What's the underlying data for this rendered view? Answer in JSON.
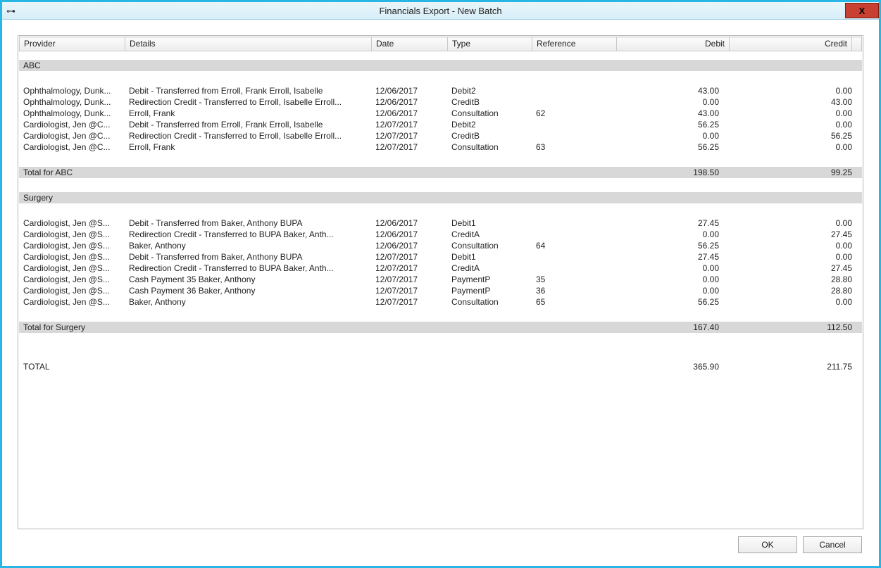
{
  "window": {
    "title": "Financials Export - New Batch",
    "close_label": "X"
  },
  "columns": {
    "provider": "Provider",
    "details": "Details",
    "date": "Date",
    "type": "Type",
    "reference": "Reference",
    "debit": "Debit",
    "credit": "Credit"
  },
  "groups": [
    {
      "name": "ABC",
      "total_label": "Total for ABC",
      "total_debit": "198.50",
      "total_credit": "99.25",
      "rows": [
        {
          "provider": "Ophthalmology, Dunk...",
          "details": "Debit - Transferred from Erroll, Frank   Erroll, Isabelle",
          "date": "12/06/2017",
          "type": "Debit2",
          "reference": "",
          "debit": "43.00",
          "credit": "0.00"
        },
        {
          "provider": "Ophthalmology, Dunk...",
          "details": "Redirection Credit - Transferred to Erroll, Isabelle   Erroll...",
          "date": "12/06/2017",
          "type": "CreditB",
          "reference": "",
          "debit": "0.00",
          "credit": "43.00"
        },
        {
          "provider": "Ophthalmology, Dunk...",
          "details": "   Erroll, Frank",
          "date": "12/06/2017",
          "type": "Consultation",
          "reference": "62",
          "debit": "43.00",
          "credit": "0.00"
        },
        {
          "provider": "Cardiologist, Jen @C...",
          "details": "Debit - Transferred from Erroll, Frank   Erroll, Isabelle",
          "date": "12/07/2017",
          "type": "Debit2",
          "reference": "",
          "debit": "56.25",
          "credit": "0.00"
        },
        {
          "provider": "Cardiologist, Jen @C...",
          "details": "Redirection Credit - Transferred to Erroll, Isabelle   Erroll...",
          "date": "12/07/2017",
          "type": "CreditB",
          "reference": "",
          "debit": "0.00",
          "credit": "56.25"
        },
        {
          "provider": "Cardiologist, Jen @C...",
          "details": "   Erroll, Frank",
          "date": "12/07/2017",
          "type": "Consultation",
          "reference": "63",
          "debit": "56.25",
          "credit": "0.00"
        }
      ]
    },
    {
      "name": "Surgery",
      "total_label": "Total for Surgery",
      "total_debit": "167.40",
      "total_credit": "112.50",
      "rows": [
        {
          "provider": "Cardiologist, Jen @S...",
          "details": "Debit - Transferred from Baker, Anthony   BUPA",
          "date": "12/06/2017",
          "type": "Debit1",
          "reference": "",
          "debit": "27.45",
          "credit": "0.00"
        },
        {
          "provider": "Cardiologist, Jen @S...",
          "details": "Redirection Credit - Transferred to BUPA   Baker, Anth...",
          "date": "12/06/2017",
          "type": "CreditA",
          "reference": "",
          "debit": "0.00",
          "credit": "27.45"
        },
        {
          "provider": "Cardiologist, Jen @S...",
          "details": "   Baker, Anthony",
          "date": "12/06/2017",
          "type": "Consultation",
          "reference": "64",
          "debit": "56.25",
          "credit": "0.00"
        },
        {
          "provider": "Cardiologist, Jen @S...",
          "details": "Debit - Transferred from Baker, Anthony   BUPA",
          "date": "12/07/2017",
          "type": "Debit1",
          "reference": "",
          "debit": "27.45",
          "credit": "0.00"
        },
        {
          "provider": "Cardiologist, Jen @S...",
          "details": "Redirection Credit - Transferred to BUPA   Baker, Anth...",
          "date": "12/07/2017",
          "type": "CreditA",
          "reference": "",
          "debit": "0.00",
          "credit": "27.45"
        },
        {
          "provider": "Cardiologist, Jen @S...",
          "details": "Cash Payment  35   Baker, Anthony",
          "date": "12/07/2017",
          "type": "PaymentP",
          "reference": "35",
          "debit": "0.00",
          "credit": "28.80"
        },
        {
          "provider": "Cardiologist, Jen @S...",
          "details": "Cash Payment  36   Baker, Anthony",
          "date": "12/07/2017",
          "type": "PaymentP",
          "reference": "36",
          "debit": "0.00",
          "credit": "28.80"
        },
        {
          "provider": "Cardiologist, Jen @S...",
          "details": "   Baker, Anthony",
          "date": "12/07/2017",
          "type": "Consultation",
          "reference": "65",
          "debit": "56.25",
          "credit": "0.00"
        }
      ]
    }
  ],
  "grand_total": {
    "label": "TOTAL",
    "debit": "365.90",
    "credit": "211.75"
  },
  "buttons": {
    "ok": "OK",
    "cancel": "Cancel"
  }
}
